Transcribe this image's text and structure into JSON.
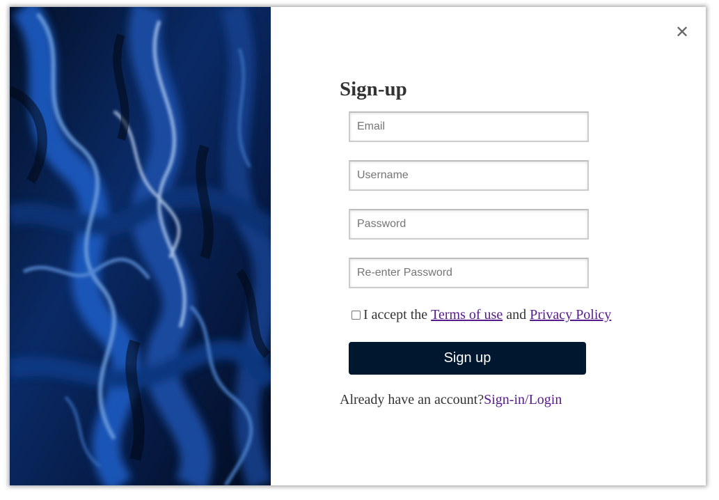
{
  "close_icon": "close-icon",
  "form": {
    "title": "Sign-up",
    "fields": {
      "email_placeholder": "Email",
      "username_placeholder": "Username",
      "password_placeholder": "Password",
      "repassword_placeholder": "Re-enter Password"
    },
    "terms": {
      "prefix": "I accept the",
      "terms_link": "Terms of use",
      "conjunction": "and",
      "privacy_link": "Privacy Policy"
    },
    "submit_label": "Sign up",
    "footer": {
      "text": "Already have an account?",
      "link": "Sign-in/Login"
    }
  },
  "colors": {
    "button_bg": "#001730",
    "link": "#551a8b",
    "text": "#333333",
    "art_base": "#06142f",
    "art_accent": "#1f5fb8"
  }
}
